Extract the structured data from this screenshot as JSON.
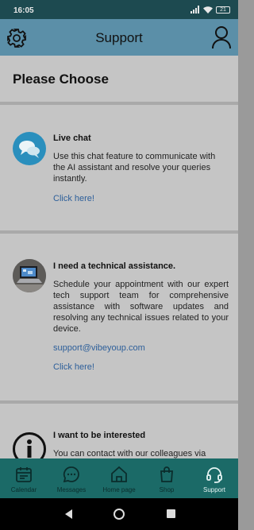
{
  "status": {
    "time": "16:05",
    "battery": "21"
  },
  "header": {
    "title": "Support"
  },
  "main": {
    "heading": "Please Choose",
    "cards": [
      {
        "title": "Live chat",
        "body": "Use this chat feature to communicate with the AI assistant and resolve your queries instantly.",
        "link": "Click here!"
      },
      {
        "title": "I need a technical assistance.",
        "body": "Schedule your appointment with our expert tech support team for comprehensive assistance with software updates and resolving any technical issues related to your device.",
        "email": "support@vibeyoup.com",
        "link": "Click here!"
      },
      {
        "title": "I want to be interested",
        "body": "You can contact with our colleagues via"
      }
    ]
  },
  "tabs": [
    {
      "label": "Calendar",
      "icon": "calendar-icon"
    },
    {
      "label": "Messages",
      "icon": "chat-bubble-icon"
    },
    {
      "label": "Home page",
      "icon": "home-icon"
    },
    {
      "label": "Shop",
      "icon": "shopping-bag-icon"
    },
    {
      "label": "Support",
      "icon": "headset-icon",
      "active": true
    }
  ],
  "colors": {
    "header": "#5b8fa8",
    "statusbar": "#1d4a50",
    "tabbar": "#1b6a67",
    "content": "#c5c5c5",
    "link": "#2d5f9a",
    "livechat_icon": "#2a8fbd"
  }
}
